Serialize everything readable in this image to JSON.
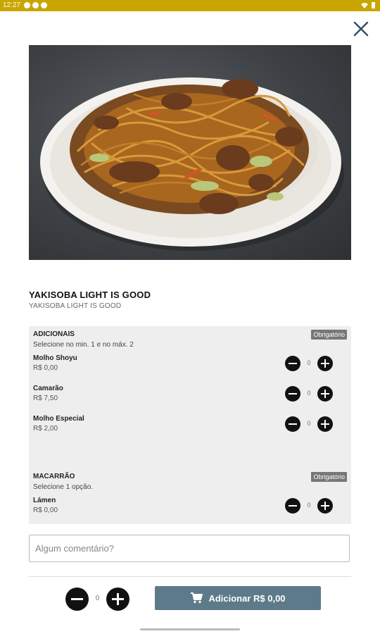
{
  "status_bar": {
    "time": "12:27"
  },
  "icons": {
    "close": "close-icon",
    "cart": "cart-icon",
    "minus": "minus-circle-icon",
    "plus": "plus-circle-icon"
  },
  "product": {
    "title": "YAKISOBA LIGHT IS GOOD",
    "subtitle": "YAKISOBA LIGHT IS GOOD"
  },
  "groups": [
    {
      "title": "ADICIONAIS",
      "hint": "Selecione no min. 1 e no máx. 2",
      "badge": "Obrigatório",
      "options": [
        {
          "name": "Molho Shoyu",
          "price": "R$ 0,00",
          "count": "0"
        },
        {
          "name": "Camarão",
          "price": "R$ 7,50",
          "count": "0"
        },
        {
          "name": "Molho Especial",
          "price": "R$ 2,00",
          "count": "0"
        }
      ]
    },
    {
      "title": "MACARRÃO",
      "hint": "Selecione 1 opção.",
      "badge": "Obrigatório",
      "options": [
        {
          "name": "Lámen",
          "price": "R$ 0,00",
          "count": "0"
        }
      ]
    }
  ],
  "comment": {
    "placeholder": "Algum comentário?"
  },
  "footer": {
    "quantity": "0",
    "add_label": "Adicionar R$ 0,00"
  },
  "colors": {
    "status_bar": "#c9a500",
    "add_button": "#5d7a8a",
    "badge": "#777777",
    "panel": "#eeeeee"
  }
}
